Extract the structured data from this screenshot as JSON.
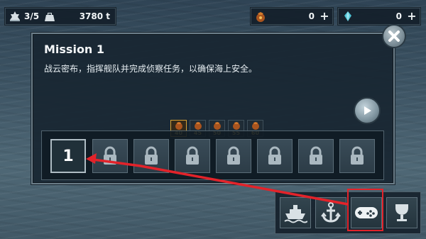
{
  "hud": {
    "fleet_count": "3/5",
    "fuel_value": "3780 t",
    "currency1_value": "0",
    "currency2_value": "0"
  },
  "mission": {
    "title": "Mission 1",
    "description": "战云密布，指挥舰队并完成侦察任务，以确保海上安全。",
    "rewards": [
      "40",
      "45",
      "50",
      "55",
      "60"
    ],
    "current_level": "1",
    "locked_levels": 7
  },
  "menu": {
    "items": [
      "ship-icon",
      "anchor-icon",
      "gamepad-icon",
      "trophy-icon"
    ],
    "highlighted": "gamepad-icon"
  },
  "colors": {
    "annotation_red": "#e3232a",
    "reward_gold": "#f6d063"
  }
}
